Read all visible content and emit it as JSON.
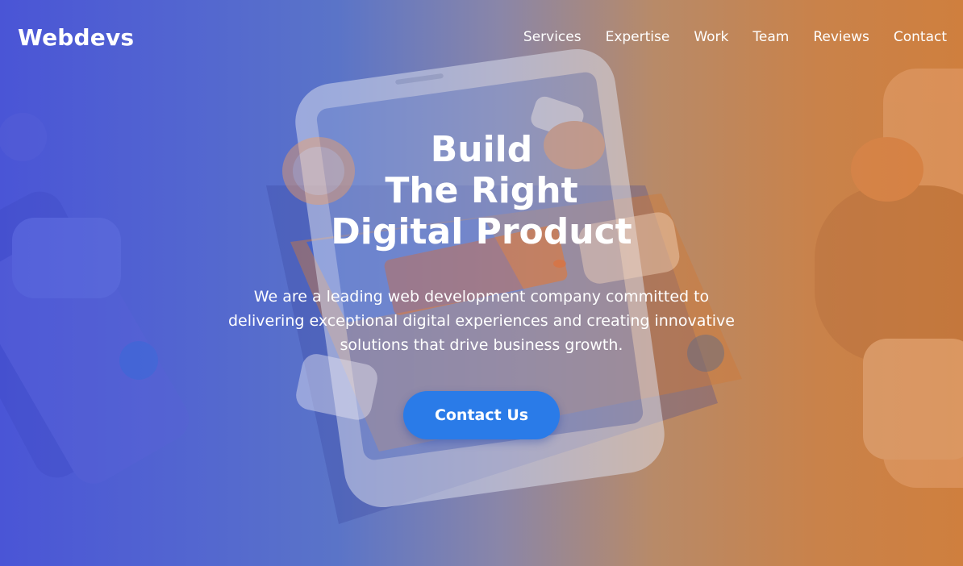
{
  "brand": {
    "name": "Webdevs"
  },
  "nav": {
    "items": [
      {
        "label": "Services"
      },
      {
        "label": "Expertise"
      },
      {
        "label": "Work"
      },
      {
        "label": "Team"
      },
      {
        "label": "Reviews"
      },
      {
        "label": "Contact"
      }
    ]
  },
  "hero": {
    "headline_lines": [
      "Build",
      "The Right",
      "Digital Product"
    ],
    "subtext": "We are a leading web development company committed to delivering exceptional digital experiences and creating innovative solutions that drive business growth.",
    "cta_label": "Contact Us",
    "background_image": "phone-illustration"
  },
  "colors": {
    "gradient_left": "#4a55d6",
    "gradient_right": "#cf7f3e",
    "cta": "#2a7be8",
    "text": "#ffffff"
  }
}
